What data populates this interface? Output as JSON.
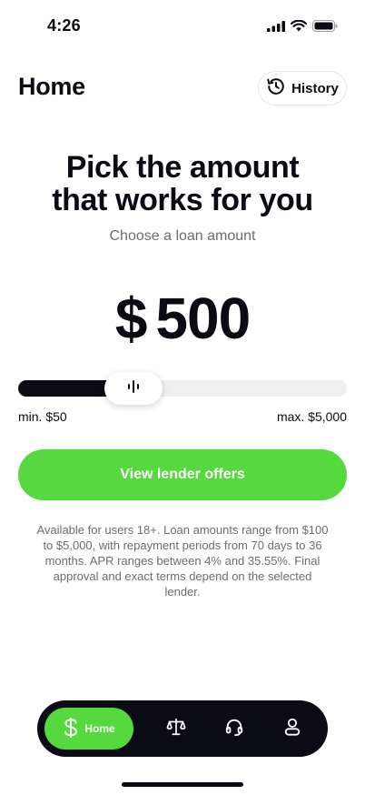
{
  "status_bar": {
    "time": "4:26",
    "icons": [
      "cellular-signal-icon",
      "wifi-icon",
      "battery-icon"
    ]
  },
  "header": {
    "title": "Home",
    "history_label": "History",
    "history_icon": "history-clock-icon"
  },
  "hero": {
    "headline_line1": "Pick the amount",
    "headline_line2": "that works for you",
    "subheadline": "Choose a loan amount"
  },
  "amount": {
    "currency_symbol": "$",
    "value": "500"
  },
  "slider": {
    "min_label": "min. $50",
    "max_label": "max. $5,000",
    "fill_fraction": 0.35
  },
  "cta": {
    "label": "View lender offers"
  },
  "disclaimer": "Available for users 18+. Loan amounts range from $100 to $5,000, with repayment periods from 70 days to 36 months. APR ranges between 4% and 35.55%. Final approval and exact terms depend on the selected lender.",
  "bottom_nav": {
    "items": [
      {
        "label": "Home",
        "icon": "dollar-icon",
        "active": true
      },
      {
        "label": "",
        "icon": "scales-icon",
        "active": false
      },
      {
        "label": "",
        "icon": "headset-icon",
        "active": false
      },
      {
        "label": "",
        "icon": "user-icon",
        "active": false
      }
    ]
  },
  "colors": {
    "accent": "#56d93f",
    "dark": "#0b0b14",
    "muted_text": "#6b6b73",
    "track": "#efefef"
  }
}
